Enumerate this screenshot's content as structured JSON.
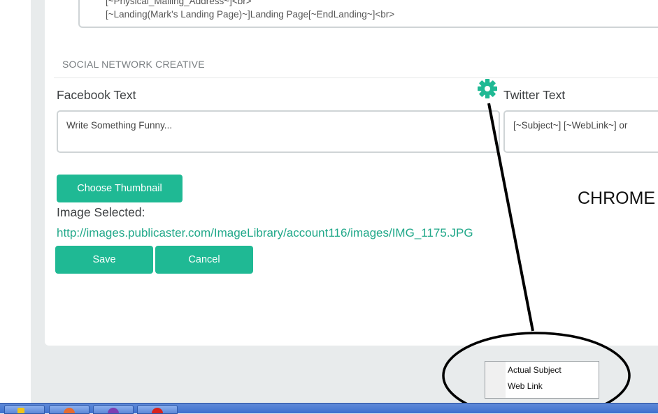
{
  "template_box": {
    "lines": [
      "[~Physical_Mailing_Address~]<br>",
      "[~Landing(Mark's Landing Page)~]Landing Page[~EndLanding~]<br>"
    ]
  },
  "social": {
    "section_title": "SOCIAL NETWORK CREATIVE",
    "facebook_label": "Facebook Text",
    "facebook_value": "Write Something Funny...",
    "twitter_label": "Twitter Text",
    "twitter_value": "[~Subject~] [~WebLink~] or",
    "choose_thumbnail": "Choose Thumbnail",
    "image_selected_label": "Image Selected:",
    "image_url": "http://images.publicaster.com/ImageLibrary/account116/images/IMG_1175.JPG",
    "save": "Save",
    "cancel": "Cancel"
  },
  "annotation": {
    "browser_label": "CHROME",
    "gear_icon": "gear-icon"
  },
  "dropdown": {
    "items": [
      "Actual Subject",
      "Web Link"
    ]
  },
  "colors": {
    "accent": "#1fb994",
    "link": "#20a889",
    "background": "#e8ebec"
  },
  "taskbar": {
    "icons": [
      "folder-icon",
      "firefox-icon",
      "app-icon",
      "red-app-icon"
    ]
  }
}
